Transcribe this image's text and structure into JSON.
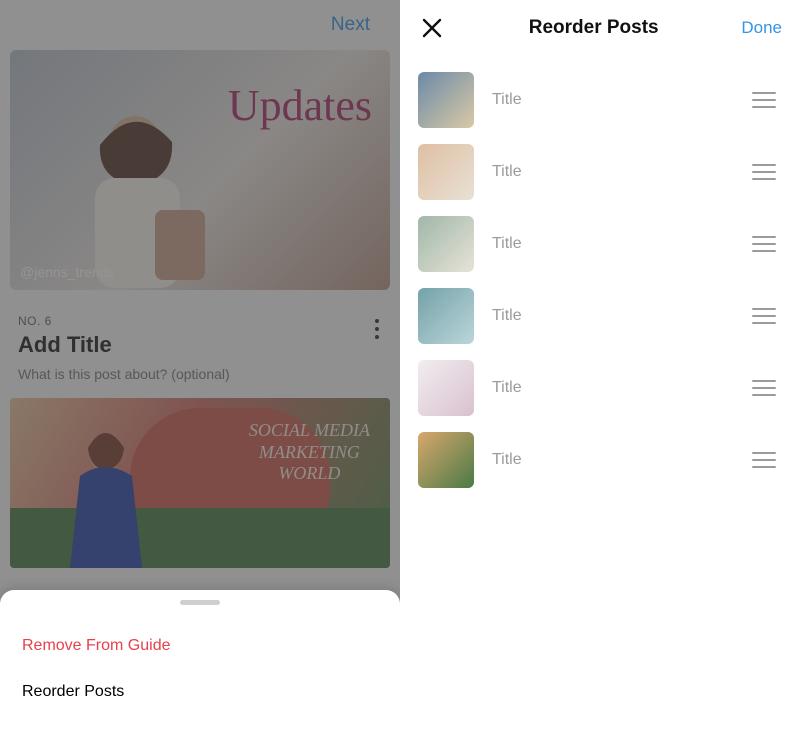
{
  "left": {
    "next_label": "Next",
    "hero_script": "Updates",
    "hero_tag": "@jenns_trends",
    "post_number": "NO. 6",
    "title_placeholder": "Add Title",
    "about_placeholder": "What is this post about? (optional)",
    "sheet": {
      "remove": "Remove From Guide",
      "reorder": "Reorder Posts"
    }
  },
  "right": {
    "title": "Reorder Posts",
    "done_label": "Done",
    "items": [
      {
        "label": "Title"
      },
      {
        "label": "Title"
      },
      {
        "label": "Title"
      },
      {
        "label": "Title"
      },
      {
        "label": "Title"
      },
      {
        "label": "Title"
      }
    ]
  }
}
